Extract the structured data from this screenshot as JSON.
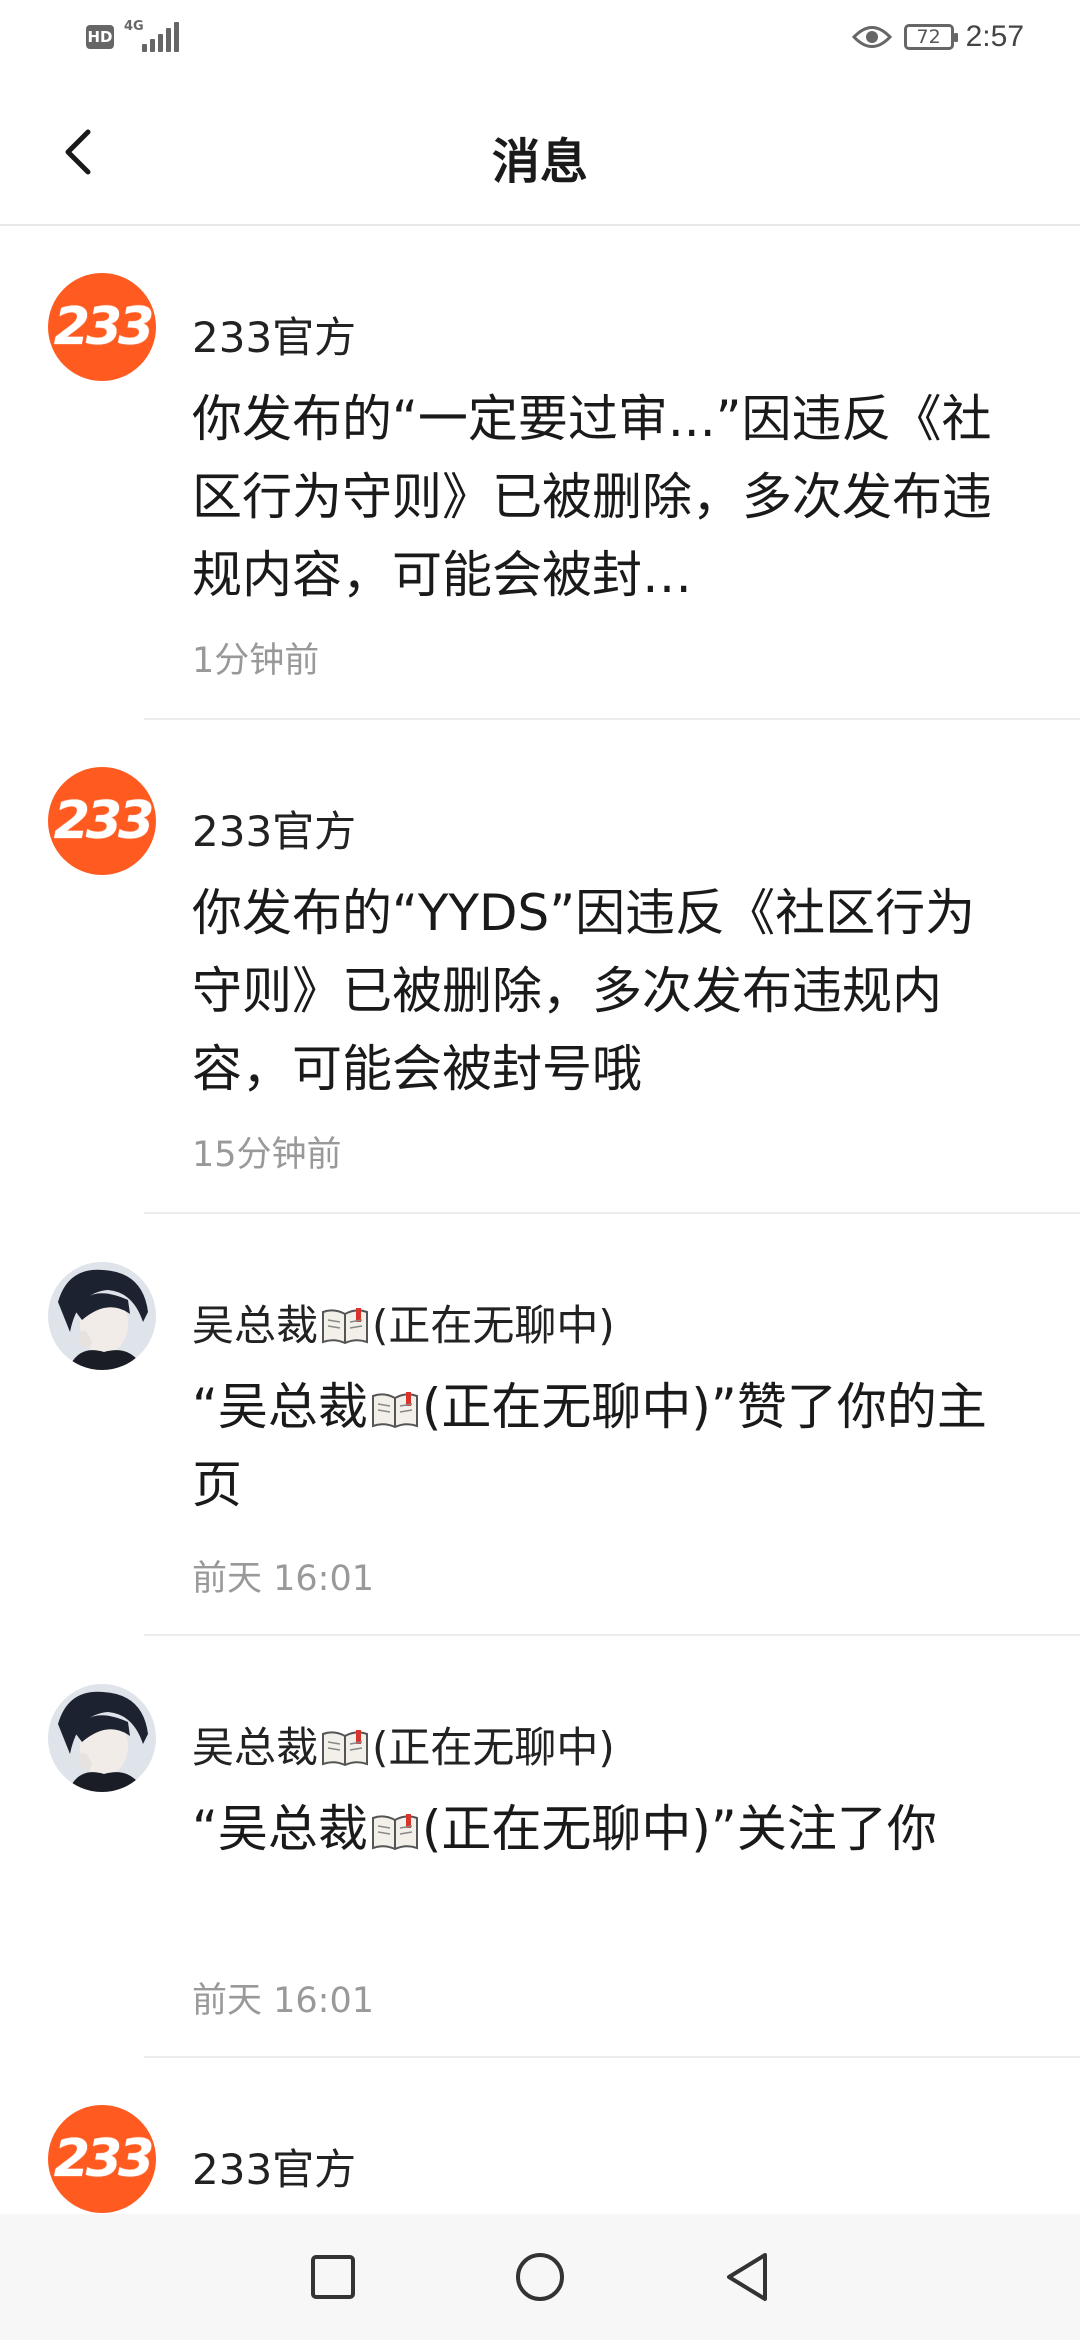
{
  "status_bar": {
    "hd": "HD",
    "network": "4G",
    "battery": "72",
    "time": "2:57"
  },
  "header": {
    "title": "消息"
  },
  "messages": [
    {
      "sender": "233官方",
      "avatar": "233-logo",
      "avatar_text": "233",
      "text": "你发布的“一定要过审...”因违反《社区行为守则》已被删除，多次发布违规内容，可能会被封…",
      "time": "1分钟前"
    },
    {
      "sender": "233官方",
      "avatar": "233-logo",
      "avatar_text": "233",
      "text": "你发布的“YYDS”因违反《社区行为守则》已被删除，多次发布违规内容，可能会被封号哦",
      "time": "15分钟前"
    },
    {
      "sender_name": "吴总裁",
      "sender_suffix": "(正在无聊中)",
      "avatar": "anime-user-avatar",
      "text_prefix": "“吴总裁",
      "text_suffix": "(正在无聊中)”赞了你的主页",
      "time": "前天 16:01"
    },
    {
      "sender_name": "吴总裁",
      "sender_suffix": "(正在无聊中)",
      "avatar": "anime-user-avatar",
      "text_prefix": "“吴总裁",
      "text_suffix": "(正在无聊中)”关注了你",
      "time": "前天 16:01"
    },
    {
      "sender": "233官方",
      "avatar": "233-logo",
      "avatar_text": "233"
    }
  ],
  "colors": {
    "brand": "#ff5a1f",
    "muted": "#999999"
  },
  "nav_icons": [
    "recent-apps-icon",
    "home-icon",
    "back-triangle-icon"
  ]
}
